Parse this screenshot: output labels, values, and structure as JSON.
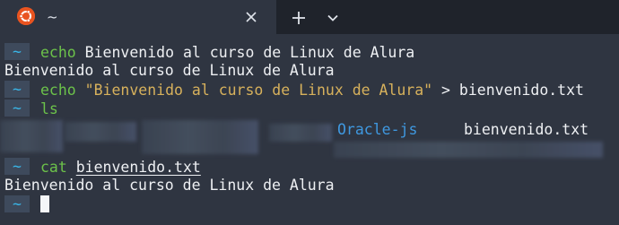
{
  "tab": {
    "title": "~",
    "icon": "ubuntu-logo-icon",
    "close_icon": "close-icon",
    "new_tab_icon": "plus-icon",
    "menu_icon": "chevron-down-icon"
  },
  "terminal": {
    "prompt_symbol": "~",
    "lines": [
      {
        "type": "command",
        "cmd": "echo",
        "rest": " Bienvenido al curso de Linux de Alura"
      },
      {
        "type": "output",
        "text": "Bienvenido al curso de Linux de Alura"
      },
      {
        "type": "command",
        "cmd": "echo",
        "string": " \"Bienvenido al curso de Linux de Alura\"",
        "rest": " > bienvenido.txt"
      },
      {
        "type": "command",
        "cmd": "ls"
      },
      {
        "type": "ls_output",
        "dir_entry": "Oracle-js",
        "file_entry": "bienvenido.txt"
      },
      {
        "type": "command",
        "cmd": "cat",
        "file": "bienvenido.txt"
      },
      {
        "type": "output",
        "text": "Bienvenido al curso de Linux de Alura"
      },
      {
        "type": "prompt_cursor"
      }
    ]
  },
  "colors": {
    "background": "#2f3541",
    "tabbar": "#1f232b",
    "prompt_bg": "#3e4a5c",
    "prompt_fg": "#39b6e8",
    "command": "#6cc24a",
    "string": "#d7b15c",
    "directory": "#3f98e0",
    "text": "#eef0f3",
    "ubuntu_orange": "#e95420"
  }
}
